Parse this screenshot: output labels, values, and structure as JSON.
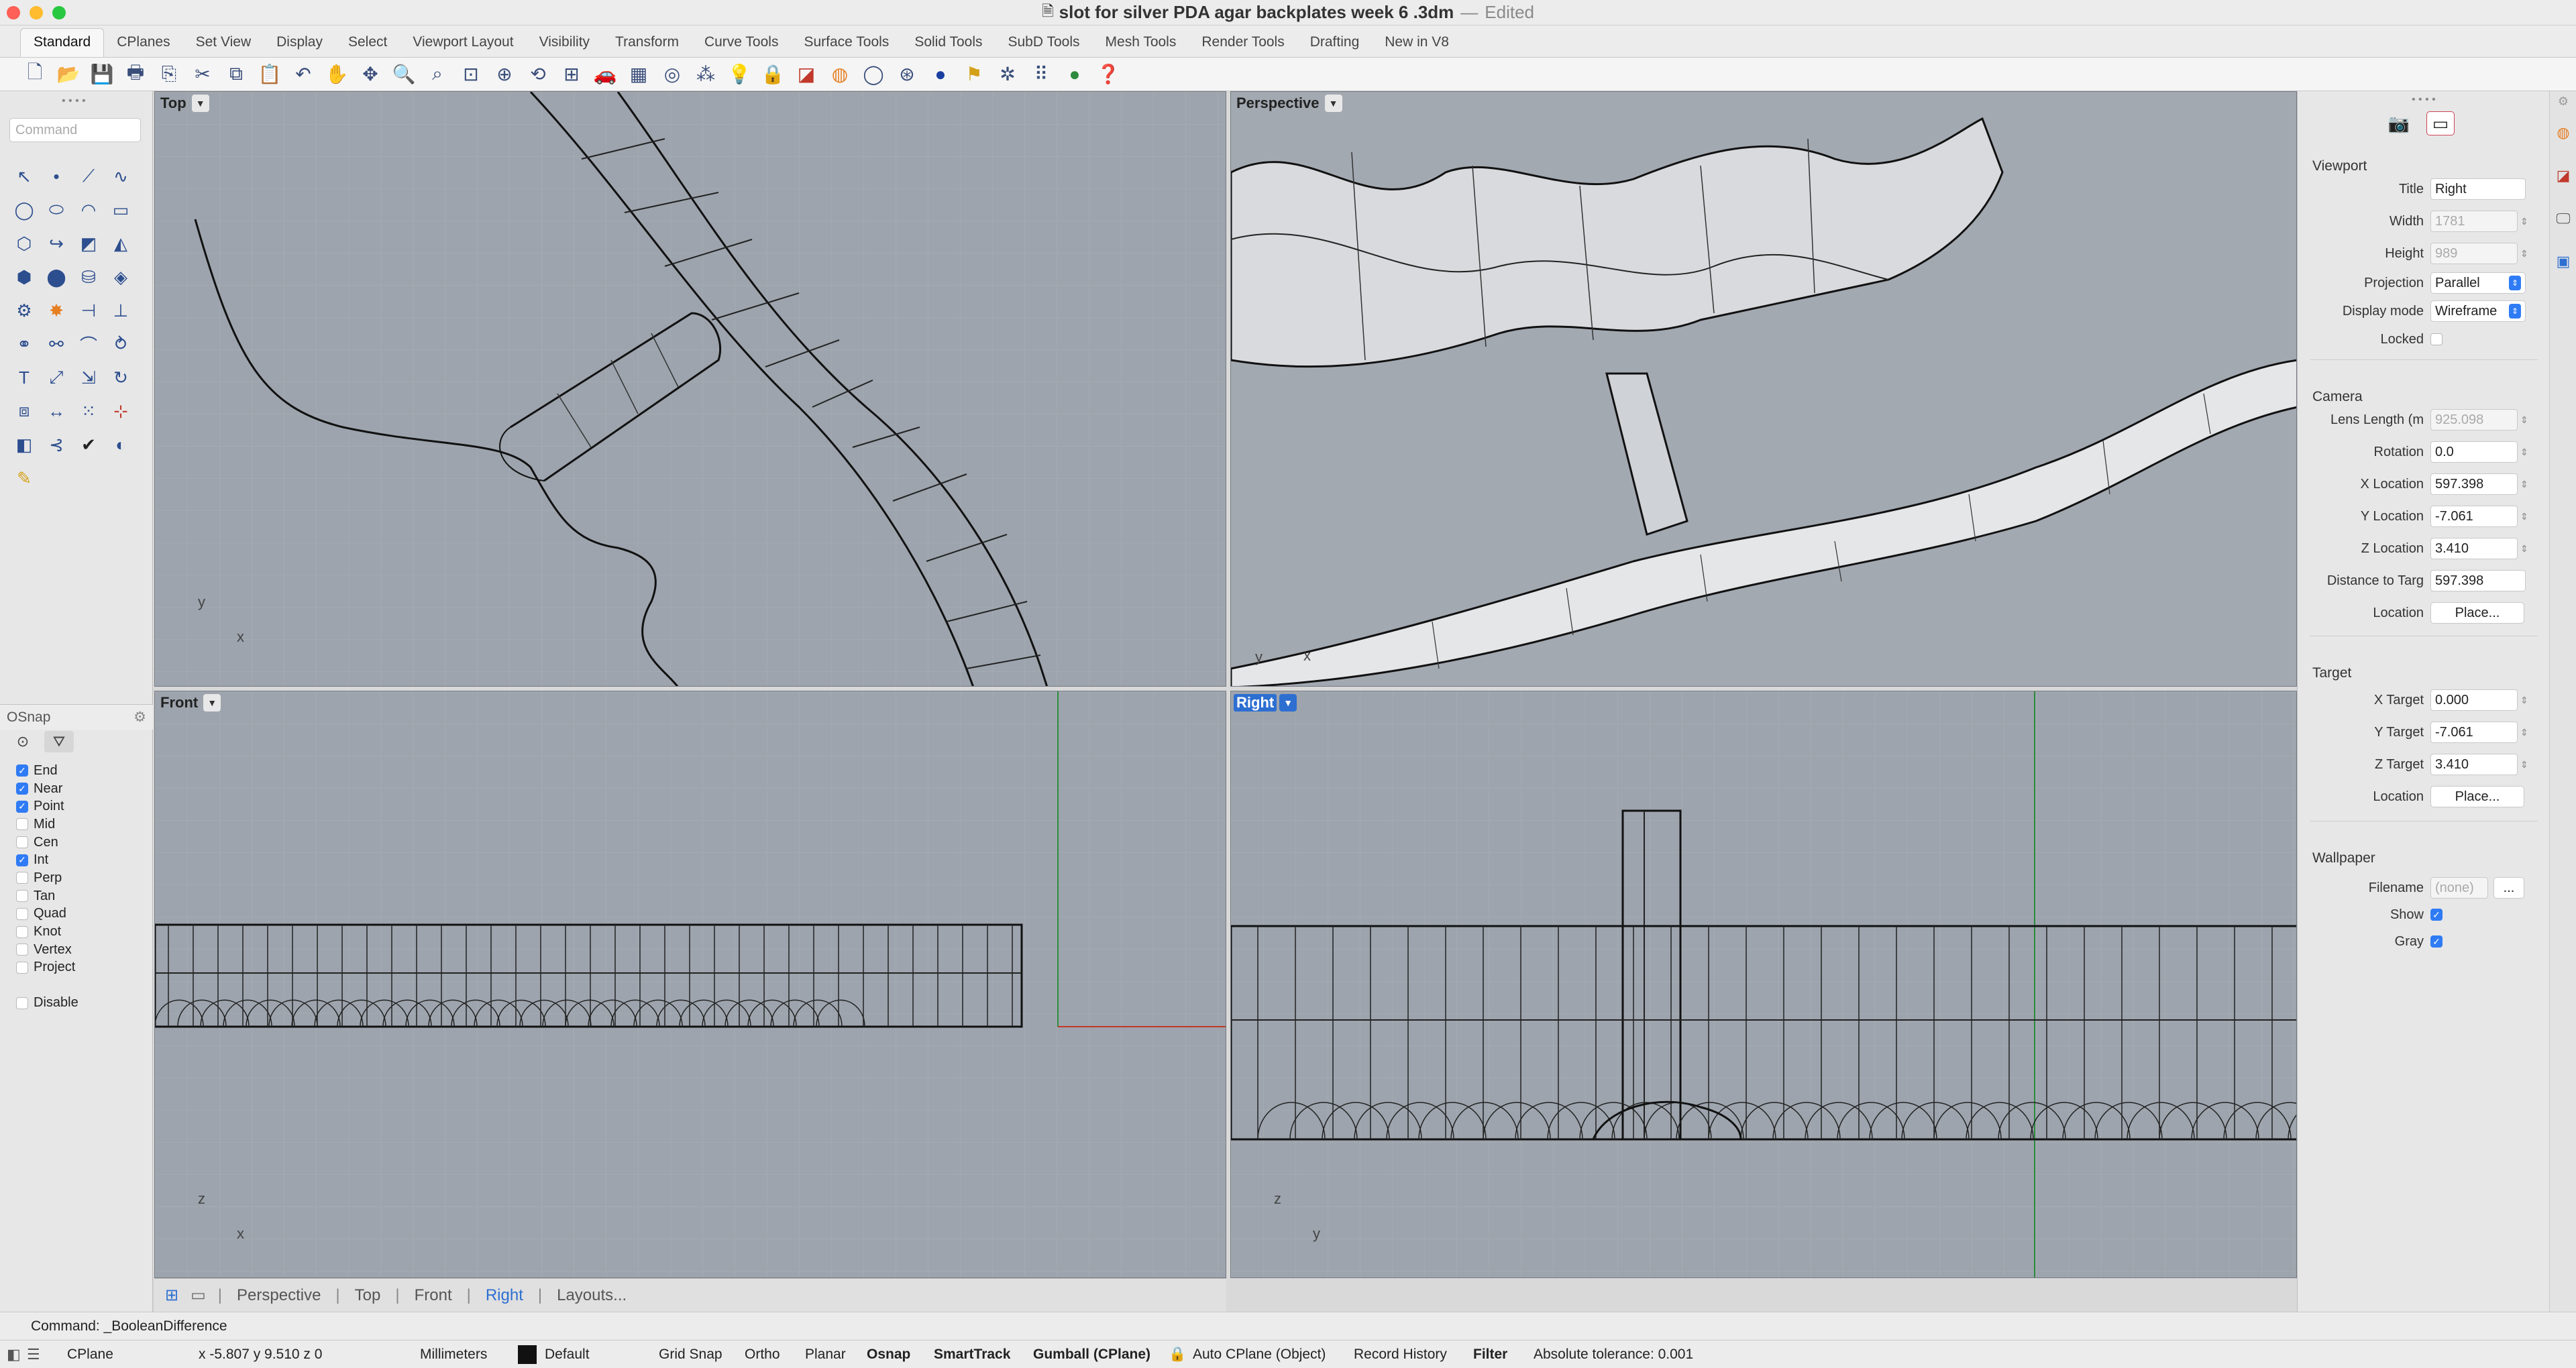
{
  "window": {
    "title": "slot for silver PDA agar backplates week 6 .3dm",
    "separator": "—",
    "edited": "Edited"
  },
  "tabs": [
    "Standard",
    "CPlanes",
    "Set View",
    "Display",
    "Select",
    "Viewport Layout",
    "Visibility",
    "Transform",
    "Curve Tools",
    "Surface Tools",
    "Solid Tools",
    "SubD Tools",
    "Mesh Tools",
    "Render Tools",
    "Drafting",
    "New in V8"
  ],
  "active_tab": "Standard",
  "command": {
    "placeholder": "Command",
    "last": "Command: _BooleanDifference"
  },
  "osnap": {
    "title": "OSnap",
    "items": [
      {
        "label": "End",
        "checked": true
      },
      {
        "label": "Near",
        "checked": true
      },
      {
        "label": "Point",
        "checked": true
      },
      {
        "label": "Mid",
        "checked": false
      },
      {
        "label": "Cen",
        "checked": false
      },
      {
        "label": "Int",
        "checked": true
      },
      {
        "label": "Perp",
        "checked": false
      },
      {
        "label": "Tan",
        "checked": false
      },
      {
        "label": "Quad",
        "checked": false
      },
      {
        "label": "Knot",
        "checked": false
      },
      {
        "label": "Vertex",
        "checked": false
      },
      {
        "label": "Project",
        "checked": false
      }
    ],
    "disable": "Disable"
  },
  "viewports": {
    "top": "Top",
    "perspective": "Perspective",
    "front": "Front",
    "right": "Right"
  },
  "axes": {
    "x": "x",
    "y": "y",
    "z": "z"
  },
  "viewport_tabs": [
    "Perspective",
    "Top",
    "Front",
    "Right",
    "Layouts..."
  ],
  "active_viewport_tab": "Right",
  "properties": {
    "viewport": {
      "heading": "Viewport",
      "title_label": "Title",
      "title": "Right",
      "width_label": "Width",
      "width": "1781",
      "height_label": "Height",
      "height": "989",
      "projection_label": "Projection",
      "projection": "Parallel",
      "display_label": "Display mode",
      "display": "Wireframe",
      "locked_label": "Locked"
    },
    "camera": {
      "heading": "Camera",
      "lens_label": "Lens Length (m",
      "lens": "925.098",
      "rotation_label": "Rotation",
      "rotation": "0.0",
      "xloc_label": "X Location",
      "xloc": "597.398",
      "yloc_label": "Y Location",
      "yloc": "-7.061",
      "zloc_label": "Z Location",
      "zloc": "3.410",
      "dist_label": "Distance to Targ",
      "dist": "597.398",
      "location_label": "Location",
      "place": "Place..."
    },
    "target": {
      "heading": "Target",
      "x_label": "X Target",
      "x": "0.000",
      "y_label": "Y Target",
      "y": "-7.061",
      "z_label": "Z Target",
      "z": "3.410",
      "location_label": "Location",
      "place": "Place..."
    },
    "wallpaper": {
      "heading": "Wallpaper",
      "filename_label": "Filename",
      "filename": "(none)",
      "browse": "...",
      "show_label": "Show",
      "gray_label": "Gray"
    }
  },
  "status": {
    "cplane": "CPlane",
    "coords": "x -5.807  y 9.510  z 0",
    "units": "Millimeters",
    "layer": "Default",
    "grid_snap": "Grid Snap",
    "ortho": "Ortho",
    "planar": "Planar",
    "osnap": "Osnap",
    "smarttrack": "SmartTrack",
    "gumball": "Gumball (CPlane)",
    "autocplane": "Auto CPlane (Object)",
    "record": "Record History",
    "filter": "Filter",
    "tolerance": "Absolute tolerance: 0.001"
  },
  "colors": {
    "accent": "#2d6fd1",
    "viewport_bg": "#9da4ad",
    "grid": "#a7aeb6",
    "xaxis": "#c0392b",
    "yaxis": "#2e8b3e"
  }
}
